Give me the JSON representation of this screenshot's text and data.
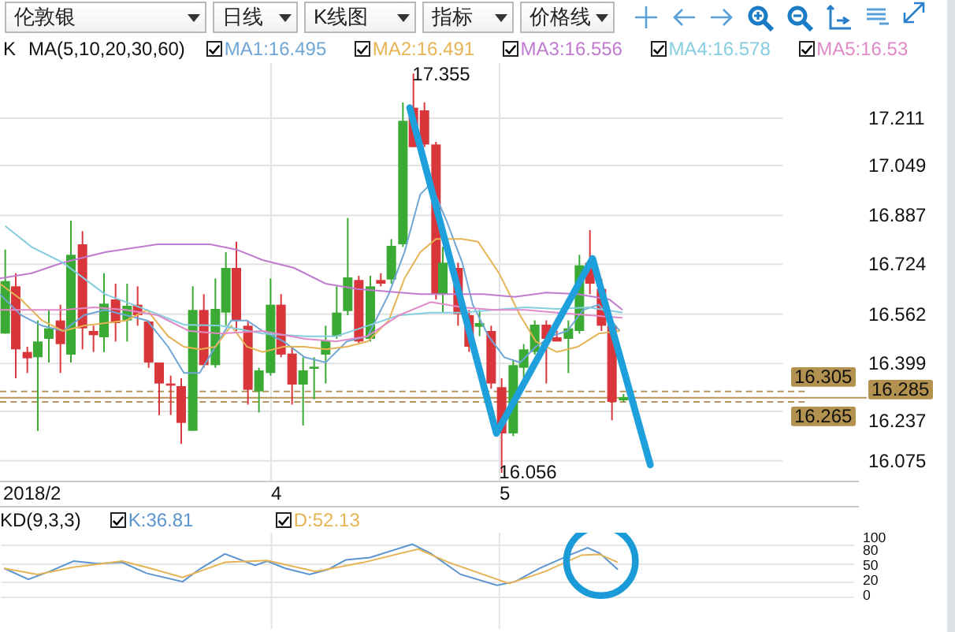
{
  "toolbar": {
    "dropdowns": [
      {
        "label": "伦敦银"
      },
      {
        "label": "日线"
      },
      {
        "label": "K线图"
      },
      {
        "label": "指标"
      },
      {
        "label": "价格线"
      }
    ]
  },
  "main_chart": {
    "indicator": "K",
    "ma_label": "MA(5,10,20,30,60)",
    "ma_lines": [
      {
        "label": "MA1:16.495",
        "checked": true,
        "color": "#6fa6d6"
      },
      {
        "label": "MA2:16.491",
        "checked": true,
        "color": "#e6b455"
      },
      {
        "label": "MA3:16.556",
        "checked": true,
        "color": "#c07ad0"
      },
      {
        "label": "MA4:16.578",
        "checked": true,
        "color": "#86cde0"
      },
      {
        "label": "MA5:16.53",
        "checked": true,
        "color": "#e08ac8"
      }
    ],
    "high_label": "17.355",
    "low_label": "16.056",
    "price_ticks": [
      "17.211",
      "17.049",
      "16.887",
      "16.724",
      "16.562",
      "16.399",
      "16.237",
      "16.075"
    ],
    "price_tags": [
      {
        "label": "16.305"
      },
      {
        "label": "16.285"
      },
      {
        "label": "16.265"
      }
    ]
  },
  "date_axis": [
    "2018/2",
    "4",
    "5"
  ],
  "kd_panel": {
    "label": "KD(9,3,3)",
    "lines": [
      {
        "label": "K:36.81",
        "checked": true,
        "color": "#5b95cf"
      },
      {
        "label": "D:52.13",
        "checked": true,
        "color": "#e6b455"
      }
    ],
    "ticks": [
      "100",
      "80",
      "50",
      "20",
      "0"
    ]
  }
}
